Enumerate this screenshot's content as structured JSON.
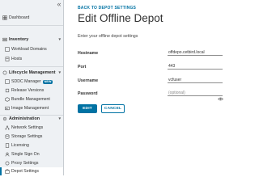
{
  "sidebar": {
    "collapse_glyph": "«",
    "dashboard": "Dashboard",
    "inventory": {
      "title": "Inventory",
      "items": [
        "Workload Domains",
        "Hosts"
      ]
    },
    "lifecycle": {
      "title": "Lifecycle Management",
      "items": [
        "SDDC Manager",
        "Release Versions",
        "Bundle Management",
        "Image Management"
      ],
      "badge": "NEW"
    },
    "administration": {
      "title": "Administration",
      "items": [
        "Network Settings",
        "Storage Settings",
        "Licensing",
        "Single Sign On",
        "Proxy Settings",
        "Depot Settings"
      ]
    },
    "active_item": "Depot Settings",
    "accent_color": "#0072a3"
  },
  "main": {
    "back_link": "BACK TO DEPOT SETTINGS",
    "title": "Edit Offline Depot",
    "subtitle": "Enter your offline depot settings",
    "fields": {
      "hostname": {
        "label": "Hostname",
        "value": "offdepo.cetbird.local"
      },
      "port": {
        "label": "Port",
        "value": "443"
      },
      "username": {
        "label": "Username",
        "value": "vcfuser"
      },
      "password": {
        "label": "Password",
        "placeholder": "(optional)"
      }
    },
    "buttons": {
      "edit": "EDIT",
      "cancel": "CANCEL"
    }
  }
}
